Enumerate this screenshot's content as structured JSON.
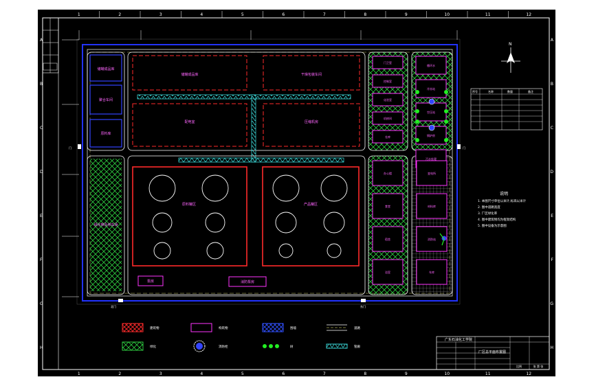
{
  "border": {
    "col_labels": [
      "1",
      "2",
      "3",
      "4",
      "5",
      "6",
      "7",
      "8",
      "9",
      "10",
      "11",
      "12"
    ],
    "row_labels": [
      "A",
      "B",
      "C",
      "D",
      "E",
      "F",
      "G",
      "H"
    ]
  },
  "plant": {
    "building_top_left_1": "储罐成品库",
    "building_top_left_2": "聚合车间",
    "building_top_left_3": "原料库",
    "building_top_right_1": "干燥包装车间",
    "building_top_right_2": "压缩机房",
    "building_mid_left": "配电室",
    "building_mid_right": "水处理车间",
    "left_column_label": "绿化带及停车场",
    "tank_area_left": "原料罐区",
    "tank_area_right": "产品罐区",
    "bottom_label_1": "泵房",
    "bottom_label_2": "消防泵房",
    "gate_left": "门",
    "gate_right": "门",
    "gate_bottom_left": "北门",
    "gate_bottom_right": "东门"
  },
  "right_buildings": {
    "col1": [
      "门卫室",
      "控制室",
      "化验室",
      "机修间",
      "仓库"
    ],
    "col2": [
      "办公楼",
      "食堂",
      "宿舍",
      "浴室"
    ],
    "col3": [
      "循环水",
      "冷冻站",
      "空压站",
      "锅炉房",
      "污水处理"
    ],
    "col4": [
      "变电所",
      "材料库",
      "消防站",
      "车库"
    ]
  },
  "legend": [
    {
      "label": "建筑物",
      "kind": "red-hatch"
    },
    {
      "label": "构筑物",
      "kind": "magenta-box"
    },
    {
      "label": "围墙",
      "kind": "blue-hatch"
    },
    {
      "label": "道路",
      "kind": "lines"
    },
    {
      "label": "绿化",
      "kind": "green-hatch"
    },
    {
      "label": "消防栓",
      "kind": "hydrant"
    },
    {
      "label": "树",
      "kind": "dots"
    },
    {
      "label": "管廊",
      "kind": "cyan-truss"
    }
  ],
  "notes": {
    "title": "说明",
    "lines": [
      "1. 本图尺寸单位以米计,标高以米计",
      "2. 图中道路宽度",
      "3. 厂区绿化率",
      "4. 图中建筑物均为框架结构",
      "5. 图中设备为示意图"
    ]
  },
  "title_block": {
    "school": "广东石油化工学院",
    "drawing_name": "厂区总平面布置图",
    "scale": "比例",
    "sheet": "张 第 张"
  },
  "compass": {
    "north": "N"
  },
  "table": {
    "headers": [
      "序号",
      "名称",
      "数量",
      "备注"
    ]
  }
}
